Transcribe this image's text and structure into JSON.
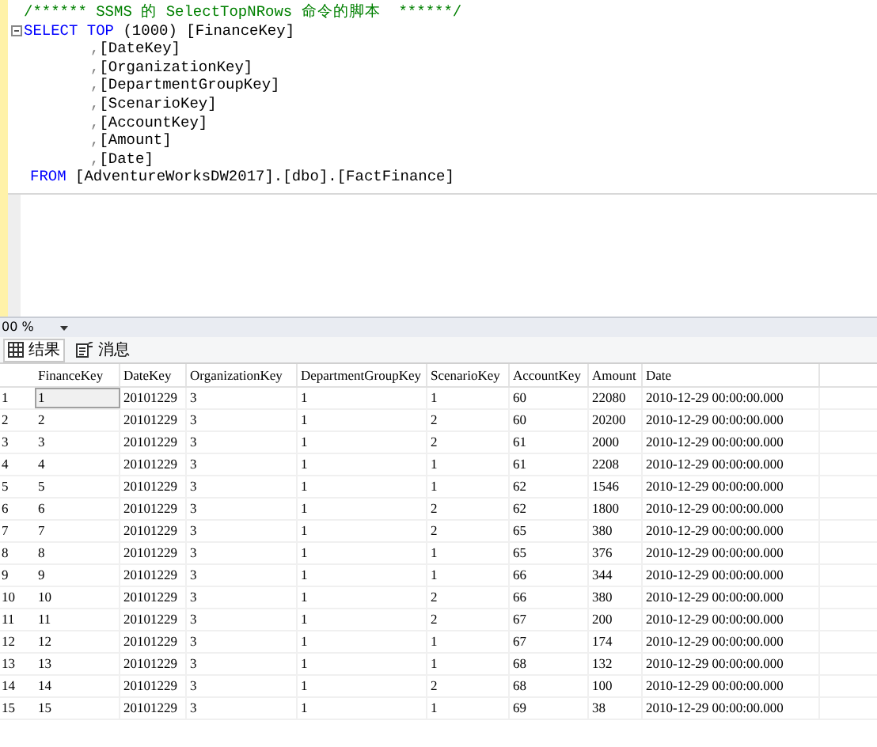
{
  "editor": {
    "lines": [
      {
        "kind": "comment",
        "segments": [
          {
            "kind": "comment",
            "text": "/****** SSMS 的 SelectTopNRows 命令的脚本  ******/"
          }
        ]
      },
      {
        "kind": "statement",
        "segments": [
          {
            "kind": "keyword",
            "text": "SELECT TOP"
          },
          {
            "kind": "text",
            "text": " (1000) [FinanceKey]"
          }
        ]
      },
      {
        "kind": "continuation",
        "segments": [
          {
            "kind": "punct",
            "text": ","
          },
          {
            "kind": "text",
            "text": "[DateKey]"
          }
        ]
      },
      {
        "kind": "continuation",
        "segments": [
          {
            "kind": "punct",
            "text": ","
          },
          {
            "kind": "text",
            "text": "[OrganizationKey]"
          }
        ]
      },
      {
        "kind": "continuation",
        "segments": [
          {
            "kind": "punct",
            "text": ","
          },
          {
            "kind": "text",
            "text": "[DepartmentGroupKey]"
          }
        ]
      },
      {
        "kind": "continuation",
        "segments": [
          {
            "kind": "punct",
            "text": ","
          },
          {
            "kind": "text",
            "text": "[ScenarioKey]"
          }
        ]
      },
      {
        "kind": "continuation",
        "segments": [
          {
            "kind": "punct",
            "text": ","
          },
          {
            "kind": "text",
            "text": "[AccountKey]"
          }
        ]
      },
      {
        "kind": "continuation",
        "segments": [
          {
            "kind": "punct",
            "text": ","
          },
          {
            "kind": "text",
            "text": "[Amount]"
          }
        ]
      },
      {
        "kind": "continuation",
        "segments": [
          {
            "kind": "punct",
            "text": ","
          },
          {
            "kind": "text",
            "text": "[Date]"
          }
        ]
      },
      {
        "kind": "from",
        "segments": [
          {
            "kind": "keyword",
            "text": "FROM"
          },
          {
            "kind": "text",
            "text": " [AdventureWorksDW2017].[dbo].[FactFinance]"
          }
        ]
      }
    ]
  },
  "zoom": {
    "value": "00 %"
  },
  "tabs": [
    {
      "label": "结果",
      "kind": "grid",
      "selected": true
    },
    {
      "label": "消息",
      "kind": "message",
      "selected": false
    }
  ],
  "grid": {
    "columns": [
      "FinanceKey",
      "DateKey",
      "OrganizationKey",
      "DepartmentGroupKey",
      "ScenarioKey",
      "AccountKey",
      "Amount",
      "Date"
    ],
    "rows": [
      {
        "number": "1",
        "selected": true,
        "cells": [
          "1",
          "20101229",
          "3",
          "1",
          "1",
          "60",
          "22080",
          "2010-12-29 00:00:00.000"
        ]
      },
      {
        "number": "2",
        "selected": false,
        "cells": [
          "2",
          "20101229",
          "3",
          "1",
          "2",
          "60",
          "20200",
          "2010-12-29 00:00:00.000"
        ]
      },
      {
        "number": "3",
        "selected": false,
        "cells": [
          "3",
          "20101229",
          "3",
          "1",
          "2",
          "61",
          "2000",
          "2010-12-29 00:00:00.000"
        ]
      },
      {
        "number": "4",
        "selected": false,
        "cells": [
          "4",
          "20101229",
          "3",
          "1",
          "1",
          "61",
          "2208",
          "2010-12-29 00:00:00.000"
        ]
      },
      {
        "number": "5",
        "selected": false,
        "cells": [
          "5",
          "20101229",
          "3",
          "1",
          "1",
          "62",
          "1546",
          "2010-12-29 00:00:00.000"
        ]
      },
      {
        "number": "6",
        "selected": false,
        "cells": [
          "6",
          "20101229",
          "3",
          "1",
          "2",
          "62",
          "1800",
          "2010-12-29 00:00:00.000"
        ]
      },
      {
        "number": "7",
        "selected": false,
        "cells": [
          "7",
          "20101229",
          "3",
          "1",
          "2",
          "65",
          "380",
          "2010-12-29 00:00:00.000"
        ]
      },
      {
        "number": "8",
        "selected": false,
        "cells": [
          "8",
          "20101229",
          "3",
          "1",
          "1",
          "65",
          "376",
          "2010-12-29 00:00:00.000"
        ]
      },
      {
        "number": "9",
        "selected": false,
        "cells": [
          "9",
          "20101229",
          "3",
          "1",
          "1",
          "66",
          "344",
          "2010-12-29 00:00:00.000"
        ]
      },
      {
        "number": "10",
        "selected": false,
        "cells": [
          "10",
          "20101229",
          "3",
          "1",
          "2",
          "66",
          "380",
          "2010-12-29 00:00:00.000"
        ]
      },
      {
        "number": "11",
        "selected": false,
        "cells": [
          "11",
          "20101229",
          "3",
          "1",
          "2",
          "67",
          "200",
          "2010-12-29 00:00:00.000"
        ]
      },
      {
        "number": "12",
        "selected": false,
        "cells": [
          "12",
          "20101229",
          "3",
          "1",
          "1",
          "67",
          "174",
          "2010-12-29 00:00:00.000"
        ]
      },
      {
        "number": "13",
        "selected": false,
        "cells": [
          "13",
          "20101229",
          "3",
          "1",
          "1",
          "68",
          "132",
          "2010-12-29 00:00:00.000"
        ]
      },
      {
        "number": "14",
        "selected": false,
        "cells": [
          "14",
          "20101229",
          "3",
          "1",
          "2",
          "68",
          "100",
          "2010-12-29 00:00:00.000"
        ]
      },
      {
        "number": "15",
        "selected": false,
        "cells": [
          "15",
          "20101229",
          "3",
          "1",
          "1",
          "69",
          "38",
          "2010-12-29 00:00:00.000"
        ]
      }
    ]
  }
}
